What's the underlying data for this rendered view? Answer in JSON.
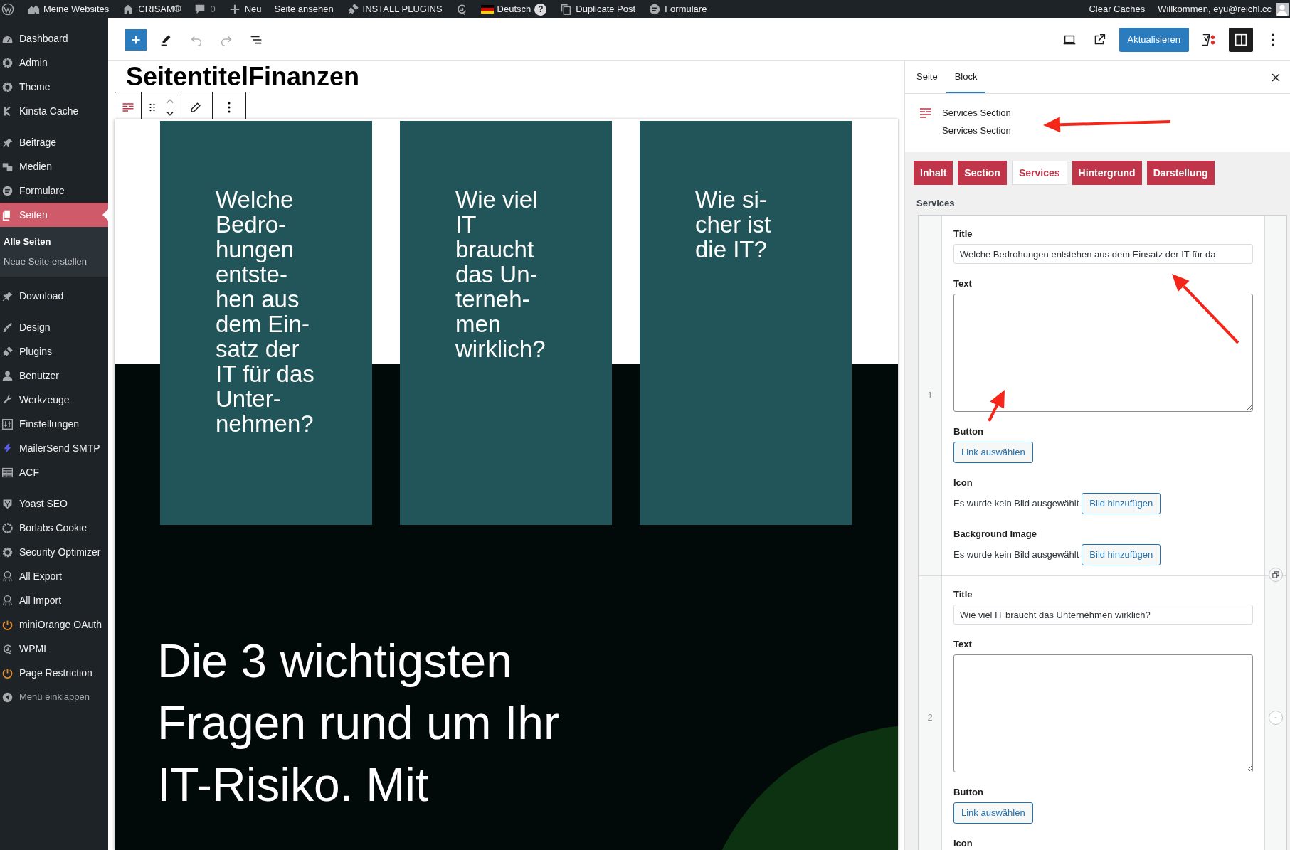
{
  "admin_bar": {
    "left": [
      {
        "kind": "wp_logo"
      },
      {
        "kind": "sites",
        "label": "Meine Websites"
      },
      {
        "kind": "home",
        "label": "CRISAM®"
      },
      {
        "kind": "comments",
        "label": "0"
      },
      {
        "kind": "new",
        "label": "Neu"
      },
      {
        "kind": "link",
        "label": "Seite ansehen"
      },
      {
        "kind": "plug",
        "label": "INSTALL PLUGINS"
      },
      {
        "kind": "wpml"
      },
      {
        "kind": "language",
        "label": "Deutsch",
        "badge": "?"
      },
      {
        "kind": "duplicate",
        "label": "Duplicate Post"
      },
      {
        "kind": "forms",
        "label": "Formulare"
      }
    ],
    "right": [
      {
        "kind": "link",
        "label": "Clear Caches"
      },
      {
        "kind": "account",
        "label": "Willkommen, eyu@reichl.cc"
      }
    ]
  },
  "sidebar": {
    "groups": [
      {
        "items": [
          {
            "label": "Dashboard",
            "selected": false
          },
          {
            "label": "Admin",
            "selected": false
          },
          {
            "label": "Theme",
            "selected": false
          },
          {
            "label": "Kinsta Cache",
            "selected": false
          }
        ]
      },
      {
        "items": [
          {
            "label": "Beiträge",
            "selected": false
          },
          {
            "label": "Medien",
            "selected": false
          },
          {
            "label": "Formulare",
            "selected": false
          },
          {
            "label": "Seiten",
            "selected": true,
            "children": [
              {
                "label": "Alle Seiten",
                "selected": true
              },
              {
                "label": "Neue Seite erstellen",
                "selected": false
              }
            ]
          }
        ]
      },
      {
        "items": [
          {
            "label": "Download",
            "selected": false
          }
        ]
      },
      {
        "items": [
          {
            "label": "Design",
            "selected": false
          },
          {
            "label": "Plugins",
            "selected": false
          },
          {
            "label": "Benutzer",
            "selected": false
          },
          {
            "label": "Werkzeuge",
            "selected": false
          },
          {
            "label": "Einstellungen",
            "selected": false
          },
          {
            "label": "MailerSend SMTP",
            "selected": false
          },
          {
            "label": "ACF",
            "selected": false
          }
        ]
      },
      {
        "items": [
          {
            "label": "Yoast SEO",
            "selected": false
          },
          {
            "label": "Borlabs Cookie",
            "selected": false
          },
          {
            "label": "Security Optimizer",
            "selected": false
          },
          {
            "label": "All Export",
            "selected": false
          },
          {
            "label": "All Import",
            "selected": false
          },
          {
            "label": "miniOrange OAuth",
            "selected": false
          },
          {
            "label": "WPML",
            "selected": false
          },
          {
            "label": "Page Restriction",
            "selected": false
          }
        ]
      }
    ],
    "collapse": "Menü einklappen"
  },
  "editor_toolbar": {
    "update_button": "Aktualisieren",
    "settings_panel_open": true
  },
  "page_title": "SeitentitelFinanzen",
  "section": {
    "cards": [
      {
        "title": "Welche\nBedro-\nhungen\nentste-\nhen aus\ndem Ein-\nsatz der\nIT für das\nUnter-\nnehmen?"
      },
      {
        "title": "Wie viel\nIT\nbraucht\ndas Un-\nterneh-\nmen\nwirklich?"
      },
      {
        "title": "Wie si-\ncher ist\ndie IT?"
      }
    ],
    "heading": "Die 3 wichtigsten\nFragen rund um Ihr\nIT-Risiko. Mit"
  },
  "settings_panel": {
    "tabs": [
      {
        "label": "Seite",
        "selected": false
      },
      {
        "label": "Block",
        "selected": true
      }
    ],
    "block": {
      "name": "Services Section",
      "description": "Services Section"
    },
    "block_tabs": [
      {
        "label": "Inhalt",
        "selected": false
      },
      {
        "label": "Section",
        "selected": false
      },
      {
        "label": "Services",
        "selected": true
      },
      {
        "label": "Hintergrund",
        "selected": false
      },
      {
        "label": "Darstellung",
        "selected": false
      }
    ],
    "group_label": "Services",
    "rows": [
      {
        "number": "1",
        "hovered": false,
        "fields": [
          {
            "kind": "text",
            "label": "Title",
            "value": "Welche Bedrohungen entstehen aus dem Einsatz der IT für da"
          },
          {
            "kind": "textarea",
            "label": "Text"
          },
          {
            "kind": "link",
            "label": "Button",
            "button": "Link auswählen"
          },
          {
            "kind": "image",
            "label": "Icon",
            "note": "Es wurde kein Bild ausgewählt",
            "button": "Bild hinzufügen"
          },
          {
            "kind": "image",
            "label": "Background Image",
            "note": "Es wurde kein Bild ausgewählt",
            "button": "Bild hinzufügen"
          }
        ]
      },
      {
        "number": "2",
        "hovered": true,
        "fields": [
          {
            "kind": "text",
            "label": "Title",
            "value": "Wie viel IT braucht das Unternehmen wirklich?"
          },
          {
            "kind": "textarea",
            "label": "Text"
          },
          {
            "kind": "link",
            "label": "Button",
            "button": "Link auswählen"
          },
          {
            "kind": "image",
            "label": "Icon"
          }
        ]
      }
    ]
  }
}
